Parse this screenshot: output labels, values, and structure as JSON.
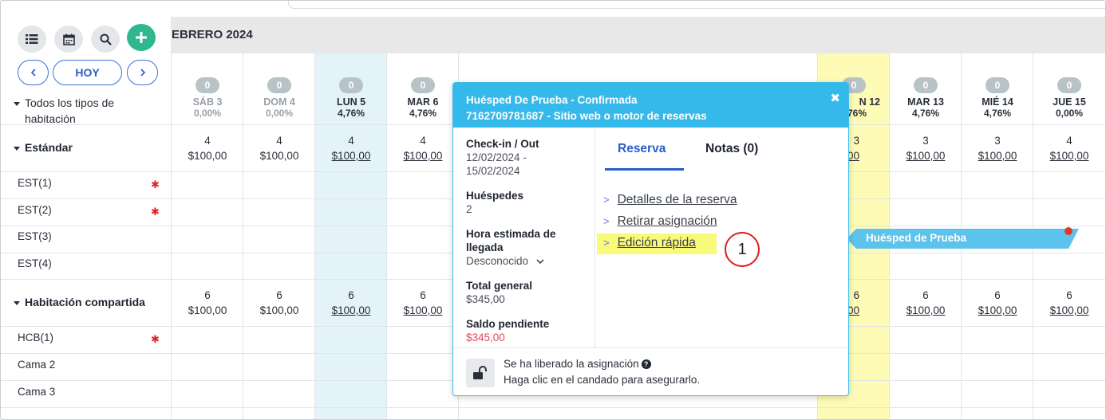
{
  "month_title": "EBRERO 2024",
  "today_label": "HOY",
  "room_types_label": "Todos los tipos de habitación",
  "days": [
    {
      "name": "SÁB 3",
      "count": "0",
      "pct": "0,00%"
    },
    {
      "name": "DOM 4",
      "count": "0",
      "pct": "0,00%"
    },
    {
      "name": "LUN 5",
      "count": "0",
      "pct": "4,76%"
    },
    {
      "name": "MAR 6",
      "count": "0",
      "pct": "4,76%"
    },
    {
      "name": "N 12",
      "count": "0",
      "pct": ".76%"
    },
    {
      "name": "MAR 13",
      "count": "0",
      "pct": "4,76%"
    },
    {
      "name": "MIÉ 14",
      "count": "0",
      "pct": "4,76%"
    },
    {
      "name": "JUE 15",
      "count": "0",
      "pct": "0,00%"
    }
  ],
  "groups": [
    {
      "name": "Estándar",
      "avail": [
        "4",
        "4",
        "4",
        "4",
        "3",
        "3",
        "3",
        "4"
      ],
      "price": [
        "$100,00",
        "$100,00",
        "$100,00",
        "$100,00",
        "00",
        "$100,00",
        "$100,00",
        "$100,00"
      ],
      "rooms": [
        "EST(1)",
        "EST(2)",
        "EST(3)",
        "EST(4)"
      ]
    },
    {
      "name": "Habitación compartida",
      "avail": [
        "6",
        "6",
        "6",
        "6",
        "6",
        "6",
        "6",
        "6"
      ],
      "price": [
        "$100,00",
        "$100,00",
        "$100,00",
        "$100,00",
        "00",
        "$100,00",
        "$100,00",
        "$100,00"
      ],
      "rooms": [
        "HCB(1)",
        "Cama 2",
        "Cama 3"
      ]
    }
  ],
  "required_mark": "✱",
  "popup": {
    "title": "Huésped De Prueba - Confirmada",
    "subtitle": "7162709781687 - Sitio web o motor de reservas",
    "close": "✖",
    "checkin_label": "Check-in / Out",
    "checkin_value": "12/02/2024 -",
    "checkout_value": "15/02/2024",
    "guests_label": "Huéspedes",
    "guests_value": "2",
    "eta_label": "Hora estimada de llegada",
    "eta_value": "Desconocido",
    "total_label": "Total general",
    "total_value": "$345,00",
    "balance_label": "Saldo pendiente",
    "balance_value": "$345,00",
    "tab_active": "Reserva",
    "tab_other": "Notas (0)",
    "links": [
      "Detalles de la reserva",
      "Retirar asignación",
      "Edición rápida"
    ],
    "foot_line1": "Se ha liberado la asignación",
    "foot_line2": "Haga clic en el candado para asegurarlo."
  },
  "step_marker": "1",
  "reservation_label": "Huésped de Prueba",
  "colors": {
    "accent_blue": "#34b9ea",
    "add_green": "#2fb88f",
    "highlight": "#f9f97a",
    "balance_red": "#e0485a"
  }
}
